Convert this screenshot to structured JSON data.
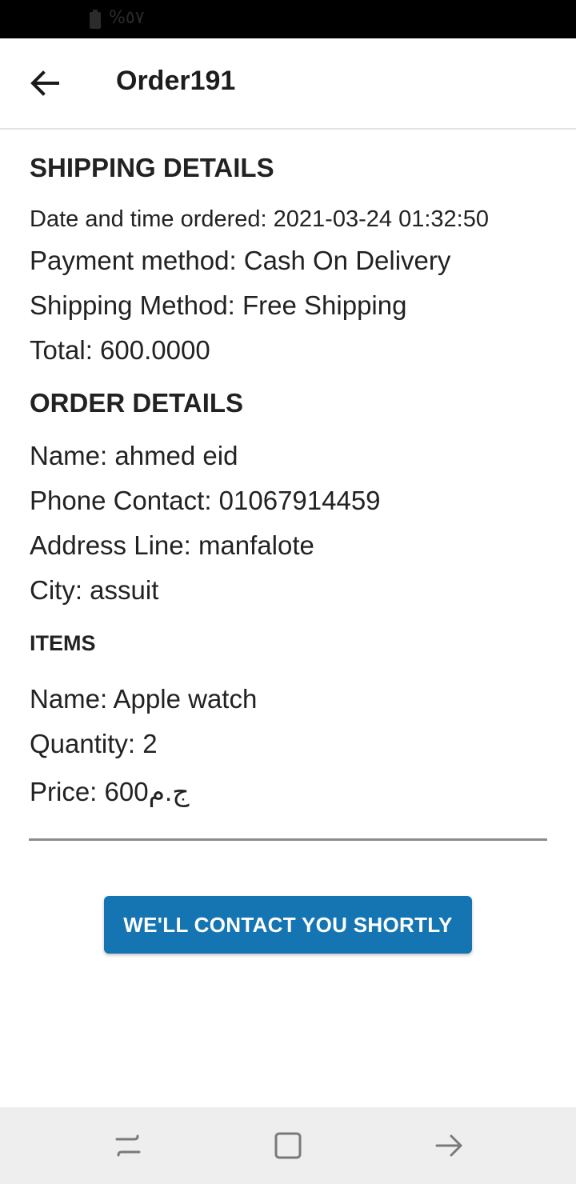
{
  "status_bar": {
    "battery_percent": "%٥٧"
  },
  "app_bar": {
    "title": "Order191"
  },
  "shipping": {
    "heading": "SHIPPING DETAILS",
    "datetime": "Date and time ordered:  2021-03-24 01:32:50",
    "payment": "Payment method: Cash On Delivery",
    "shipping_method": "Shipping Method: Free Shipping",
    "total": "Total: 600.0000"
  },
  "order": {
    "heading": "ORDER DETAILS",
    "name": "Name: ahmed eid",
    "phone": "Phone Contact: 01067914459",
    "address": "Address Line: manfalote",
    "city": "City: assuit"
  },
  "items": {
    "heading": "ITEMS",
    "list": [
      {
        "name": "Name: Apple watch",
        "quantity": "Quantity: 2",
        "price": "Price: 600ج.م"
      }
    ]
  },
  "cta": {
    "label": "WE'LL CONTACT YOU SHORTLY"
  },
  "icons": {
    "back": "arrow-left-icon",
    "recent": "recent-apps-icon",
    "home": "home-icon",
    "nav_back": "nav-back-icon"
  }
}
